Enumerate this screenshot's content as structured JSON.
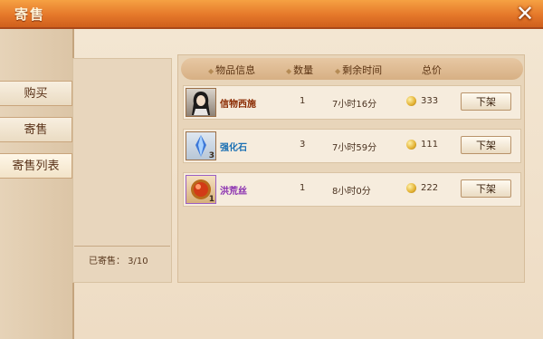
{
  "window": {
    "title": "寄售",
    "close_icon": "close-icon"
  },
  "sidebar": {
    "items": [
      {
        "label": "购买"
      },
      {
        "label": "寄售"
      },
      {
        "label": "寄售列表"
      }
    ]
  },
  "summary": {
    "count_text": "已寄售： 3/10"
  },
  "table": {
    "columns": [
      "物品信息",
      "数量",
      "剩余时间",
      "总价"
    ],
    "rows": [
      {
        "name": "信物西施",
        "name_color": "#8a2a00",
        "qty": "1",
        "time": "7小时16分",
        "price": "333",
        "action": "下架",
        "icon": "character-portrait-icon",
        "badge": ""
      },
      {
        "name": "强化石",
        "name_color": "#1a6fb3",
        "qty": "3",
        "time": "7小时59分",
        "price": "111",
        "action": "下架",
        "icon": "blue-crystal-icon",
        "badge": "3"
      },
      {
        "name": "洪荒丝",
        "name_color": "#8a2fb0",
        "qty": "1",
        "time": "8小时0分",
        "price": "222",
        "action": "下架",
        "icon": "red-orb-icon",
        "badge": "1"
      }
    ]
  },
  "colors": {
    "title_bar": "#e5782a",
    "panel": "#f3e6d2"
  }
}
